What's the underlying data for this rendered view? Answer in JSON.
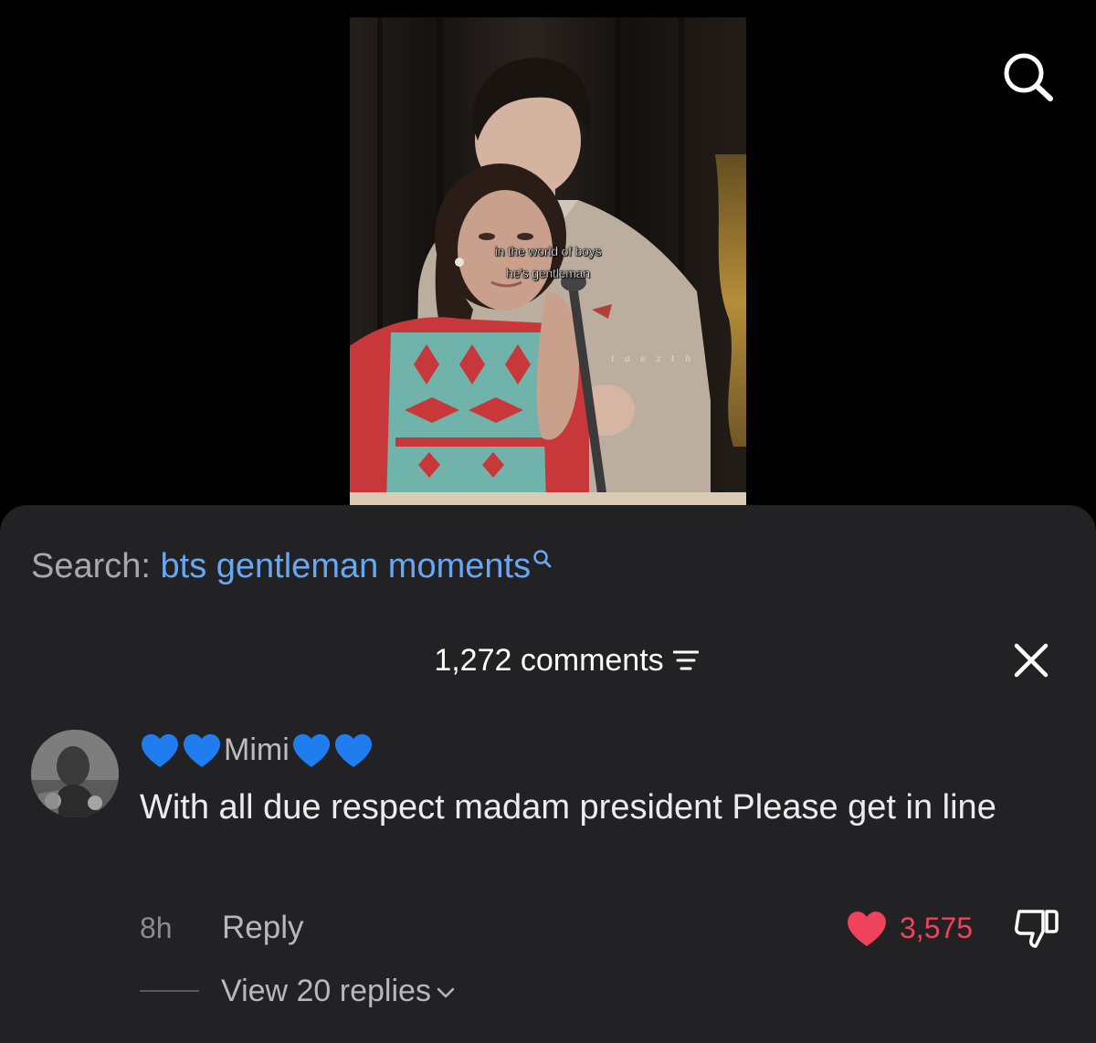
{
  "video": {
    "caption_line1": "in the world of boys",
    "caption_line2": "he's gentleman",
    "watermark": "t a e z t h"
  },
  "top_bar": {
    "search_icon": "search-icon"
  },
  "search_suggestion": {
    "prefix": "Search:",
    "term": "bts gentleman moments",
    "icon": "search-icon"
  },
  "comments": {
    "count_label": "1,272 comments",
    "sort_icon": "filter-lines-icon",
    "close_icon": "close-icon"
  },
  "comment": {
    "username": "Mimi",
    "username_emoji": "blue-heart-emoji",
    "text": "With all due respect madam president Please get in line",
    "time": "8h",
    "reply_label": "Reply",
    "like_count": "3,575",
    "liked": true,
    "like_icon": "heart-icon",
    "dislike_icon": "thumbs-down-icon",
    "view_replies_label": "View 20 replies",
    "chevron_icon": "chevron-down-icon"
  },
  "colors": {
    "sheet_bg": "#222224",
    "link_blue": "#6aa7f3",
    "like_red": "#f0425a"
  }
}
